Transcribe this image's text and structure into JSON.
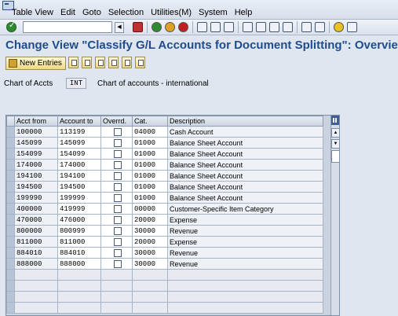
{
  "menu": [
    "Table View",
    "Edit",
    "Goto",
    "Selection",
    "Utilities(M)",
    "System",
    "Help"
  ],
  "title": "Change View \"Classify G/L Accounts for Document Splitting\": Overview",
  "app_toolbar": {
    "new_entries": "New Entries"
  },
  "header": {
    "chart_label": "Chart of Accts",
    "chart_value": "INT",
    "chart_desc": "Chart of accounts - international"
  },
  "table": {
    "columns": [
      "Acct from",
      "Account to",
      "Overrd.",
      "Cat.",
      "Description"
    ],
    "rows": [
      {
        "from": "100000",
        "to": "113199",
        "overrd": false,
        "cat": "04000",
        "desc": "Cash Account"
      },
      {
        "from": "145099",
        "to": "145099",
        "overrd": false,
        "cat": "01000",
        "desc": "Balance Sheet Account"
      },
      {
        "from": "154099",
        "to": "154099",
        "overrd": false,
        "cat": "01000",
        "desc": "Balance Sheet Account"
      },
      {
        "from": "174000",
        "to": "174000",
        "overrd": false,
        "cat": "01000",
        "desc": "Balance Sheet Account"
      },
      {
        "from": "194100",
        "to": "194100",
        "overrd": false,
        "cat": "01000",
        "desc": "Balance Sheet Account"
      },
      {
        "from": "194500",
        "to": "194500",
        "overrd": false,
        "cat": "01000",
        "desc": "Balance Sheet Account"
      },
      {
        "from": "199990",
        "to": "199999",
        "overrd": false,
        "cat": "01000",
        "desc": "Balance Sheet Account"
      },
      {
        "from": "400000",
        "to": "419999",
        "overrd": false,
        "cat": "00000",
        "desc": "Customer-Specific Item Category"
      },
      {
        "from": "470000",
        "to": "476000",
        "overrd": false,
        "cat": "20000",
        "desc": "Expense"
      },
      {
        "from": "800000",
        "to": "800999",
        "overrd": false,
        "cat": "30000",
        "desc": "Revenue"
      },
      {
        "from": "811000",
        "to": "811000",
        "overrd": false,
        "cat": "20000",
        "desc": "Expense"
      },
      {
        "from": "884010",
        "to": "884010",
        "overrd": false,
        "cat": "30000",
        "desc": "Revenue"
      },
      {
        "from": "888000",
        "to": "888000",
        "overrd": false,
        "cat": "30000",
        "desc": "Revenue"
      }
    ]
  },
  "colors": {
    "title": "#1f4c8c",
    "background": "#dfe6ef"
  }
}
